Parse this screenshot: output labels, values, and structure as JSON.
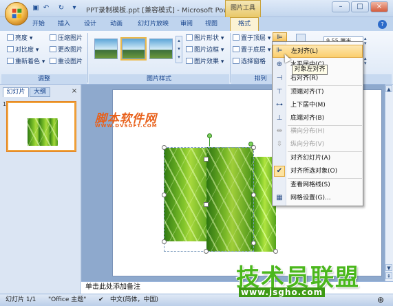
{
  "titlebar": {
    "title": "PPT录制模板.ppt [兼容模式] - Microsoft PowerP...",
    "tools_tab": "图片工具",
    "min": "–",
    "max": "□",
    "close": "×"
  },
  "tabs": [
    "开始",
    "插入",
    "设计",
    "动画",
    "幻灯片放映",
    "审阅",
    "视图"
  ],
  "format_tab": "格式",
  "ribbon": {
    "adjust": {
      "label": "调整",
      "brightness": "亮度 ▾",
      "contrast": "对比度 ▾",
      "recolor": "重新着色 ▾",
      "compress": "压缩图片",
      "change": "更改图片",
      "reset": "重设图片"
    },
    "styles": {
      "label": "图片样式",
      "shape": "图片形状 ▾",
      "border": "图片边框 ▾",
      "effects": "图片效果 ▾"
    },
    "arrange": {
      "label": "排列",
      "front": "置于顶层 ▾",
      "back": "置于底层 ▾",
      "pane": "选择窗格",
      "align_btn": "⊫"
    },
    "size": {
      "height": "9.55 厘米",
      "width": "厘米"
    }
  },
  "panel": {
    "tab_slides": "幻灯片",
    "tab_outline": "大纲",
    "close": "×",
    "slide_number": "1"
  },
  "menu": {
    "items": [
      {
        "label": "左对齐(L)",
        "icon": "align-left-icon",
        "state": "highlighted"
      },
      {
        "label": "水平居中(C)",
        "icon": "align-center-icon",
        "state": "normal"
      },
      {
        "label": "右对齐(R)",
        "icon": "align-right-icon",
        "state": "normal"
      },
      {
        "label": "顶端对齐(T)",
        "icon": "align-top-icon",
        "state": "normal"
      },
      {
        "label": "上下居中(M)",
        "icon": "align-middle-icon",
        "state": "normal"
      },
      {
        "label": "底端对齐(B)",
        "icon": "align-bottom-icon",
        "state": "normal"
      },
      {
        "label": "横向分布(H)",
        "icon": "distribute-horizontal-icon",
        "state": "disabled"
      },
      {
        "label": "纵向分布(V)",
        "icon": "distribute-vertical-icon",
        "state": "disabled"
      },
      {
        "label": "对齐幻灯片(A)",
        "icon": "align-to-slide-icon",
        "state": "normal"
      },
      {
        "label": "对齐所选对象(O)",
        "icon": "check-icon",
        "state": "checked"
      },
      {
        "label": "查看网格线(S)",
        "icon": "",
        "state": "normal"
      },
      {
        "label": "网格设置(G)...",
        "icon": "grid-icon",
        "state": "normal"
      }
    ],
    "tooltip": "对象左对齐"
  },
  "notes": "单击此处添加备注",
  "status": {
    "slide": "幻灯片 1/1",
    "theme": "\"Office 主题\"",
    "lang": "中文(简体，中国)",
    "zoom": "⊕"
  },
  "watermarks": {
    "site1": "脚本软件网",
    "site1_url": "WWW.DVSOFT.COM",
    "site2": "技术员联盟",
    "site2_url": "www.jsgho.com"
  },
  "colors": {
    "ribbon_accent": "#bfd4ee",
    "tools_tab": "#e9c868",
    "menu_highlight": "#fbcf6e"
  }
}
